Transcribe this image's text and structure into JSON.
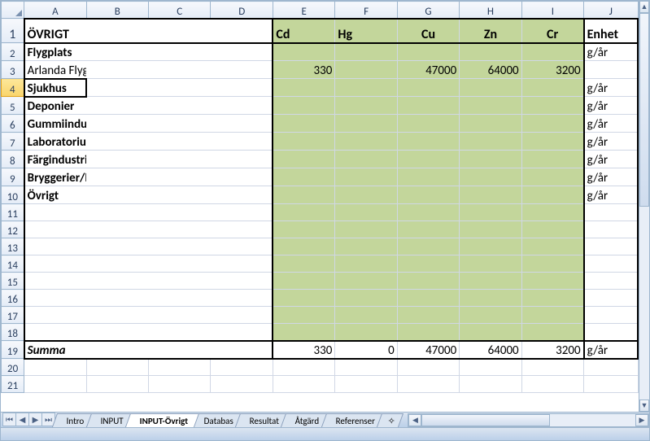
{
  "columns": [
    "",
    "A",
    "B",
    "C",
    "D",
    "E",
    "F",
    "G",
    "H",
    "I",
    "J"
  ],
  "rowcount": 21,
  "header": {
    "title": "ÖVRIGT",
    "cols": [
      "Cd",
      "Hg",
      "Cu",
      "Zn",
      "Cr"
    ],
    "unit_header": "Enhet"
  },
  "rows": [
    {
      "r": 2,
      "label": "Flygplats",
      "bold": true,
      "unit": "g/år"
    },
    {
      "r": 3,
      "label": "Arlanda Flygplats",
      "bold": false,
      "vals": {
        "E": "330",
        "G": "47000",
        "H": "64000",
        "I": "3200"
      },
      "unit": ""
    },
    {
      "r": 4,
      "label": "Sjukhus",
      "bold": true,
      "unit": "g/år",
      "selected": true
    },
    {
      "r": 5,
      "label": "Deponier",
      "bold": true,
      "unit": "g/år"
    },
    {
      "r": 6,
      "label": "Gummiindustri",
      "bold": true,
      "unit": "g/år"
    },
    {
      "r": 7,
      "label": "Laboratorium",
      "bold": true,
      "unit": "g/år"
    },
    {
      "r": 8,
      "label": "Färgindustri/måleriföretag",
      "bold": true,
      "unit": "g/år"
    },
    {
      "r": 9,
      "label": "Bryggerier/Läskedryckstillverkning",
      "bold": true,
      "unit": "g/år"
    },
    {
      "r": 10,
      "label": "Övrigt",
      "bold": true,
      "unit": "g/år"
    }
  ],
  "sum": {
    "label": "Summa",
    "vals": {
      "E": "330",
      "F": "0",
      "G": "47000",
      "H": "64000",
      "I": "3200"
    },
    "unit": "g/år"
  },
  "tabs": [
    "Intro",
    "INPUT",
    "INPUT-Övrigt",
    "Databas",
    "Resultat",
    "Åtgärd",
    "Referenser"
  ],
  "active_tab": "INPUT-Övrigt",
  "active_cell": {
    "row": 4,
    "col": "A"
  }
}
